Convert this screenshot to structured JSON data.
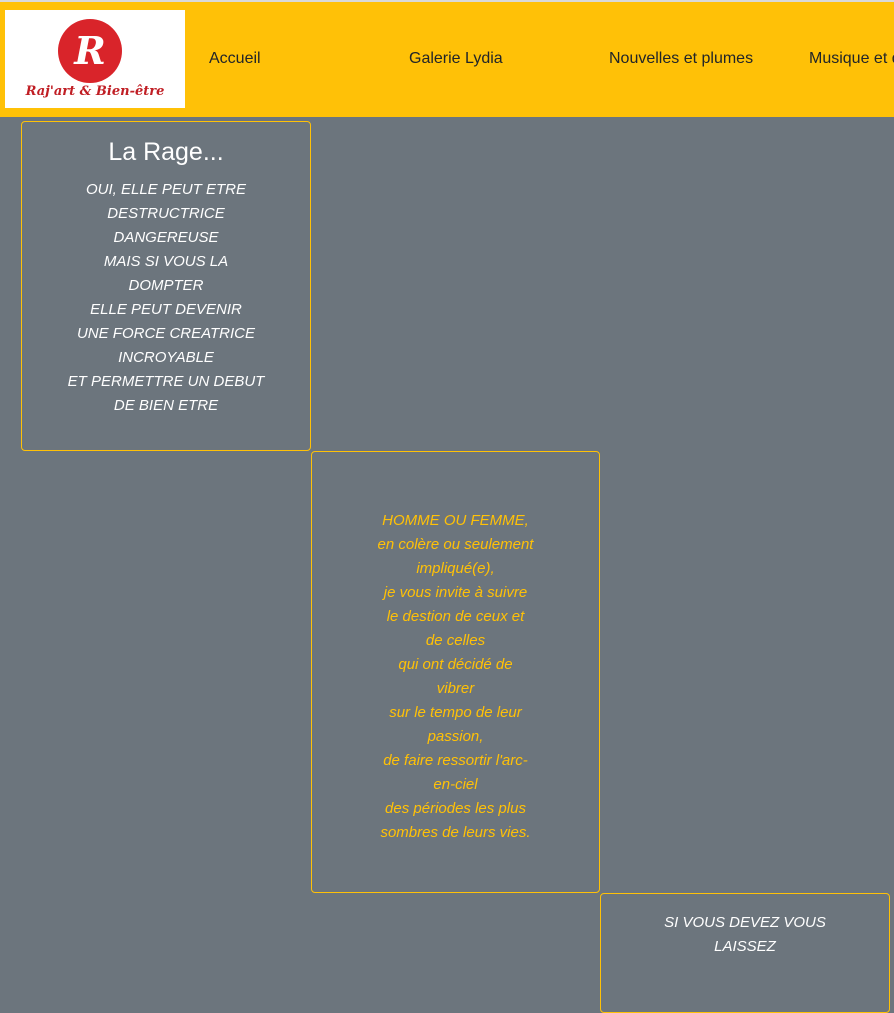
{
  "header": {
    "logo": {
      "letter": "R",
      "text": "Raj'art & Bien-être"
    },
    "nav": [
      {
        "label": "Accueil"
      },
      {
        "label": "Galerie Lydia"
      },
      {
        "label": "Nouvelles et plumes"
      },
      {
        "label": "Musique et danse"
      }
    ]
  },
  "cards": [
    {
      "title": "La Rage...",
      "lines": [
        "OUI, ELLE PEUT ETRE",
        "DESTRUCTRICE",
        "DANGEREUSE",
        "MAIS SI VOUS LA",
        "DOMPTER",
        "ELLE PEUT DEVENIR",
        "UNE FORCE CREATRICE",
        "INCROYABLE",
        "ET PERMETTRE UN DEBUT",
        "DE BIEN ETRE"
      ]
    },
    {
      "lines": [
        "HOMME OU FEMME,",
        "en colère ou seulement",
        "impliqué(e),",
        "je vous invite à suivre",
        "le destion de ceux et",
        "de celles",
        "qui ont décidé de",
        "vibrer",
        "sur le tempo de leur",
        "passion,",
        "de faire ressortir l'arc-",
        "en-ciel",
        "des périodes les plus",
        "sombres de leurs vies."
      ]
    },
    {
      "lines": [
        "SI VOUS DEVEZ VOUS",
        "LAISSEZ"
      ]
    }
  ],
  "colors": {
    "header_bg": "#ffc107",
    "page_bg": "#6c757d",
    "logo_red": "#d9242a"
  }
}
